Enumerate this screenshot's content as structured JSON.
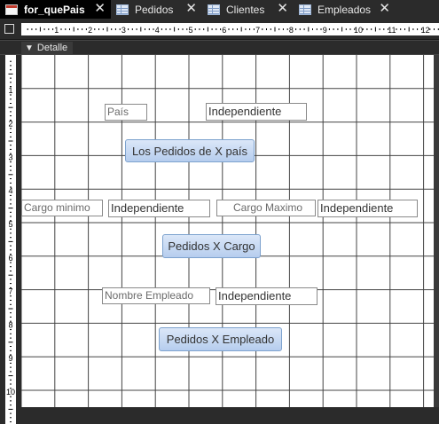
{
  "tabs": [
    {
      "label": "for_quePais",
      "icon": "form-icon"
    },
    {
      "label": "Pedidos",
      "icon": "table-icon"
    },
    {
      "label": "Clientes",
      "icon": "table-icon"
    },
    {
      "label": "Empleados",
      "icon": "table-icon"
    }
  ],
  "close_glyph": "✕",
  "ruler": {
    "h_numbers": [
      "1",
      "2",
      "3",
      "4",
      "5",
      "6",
      "7",
      "8",
      "9",
      "10",
      "11",
      "12"
    ],
    "v_numbers": [
      "1",
      "2",
      "3",
      "4",
      "5",
      "6",
      "7",
      "8",
      "9",
      "10"
    ]
  },
  "section": {
    "label": "Detalle"
  },
  "form": {
    "pais_label": "País",
    "pais_text": "Independiente",
    "btn_pais": "Los Pedidos de X país",
    "cargo_min_label": "Cargo minimo",
    "cargo_min_text": "Independiente",
    "cargo_max_label": "Cargo Maximo",
    "cargo_max_text": "Independiente",
    "btn_cargo": "Pedidos X Cargo",
    "nombre_label": "Nombre Empleado",
    "nombre_text": "Independiente",
    "btn_empleado": "Pedidos X Empleado"
  }
}
